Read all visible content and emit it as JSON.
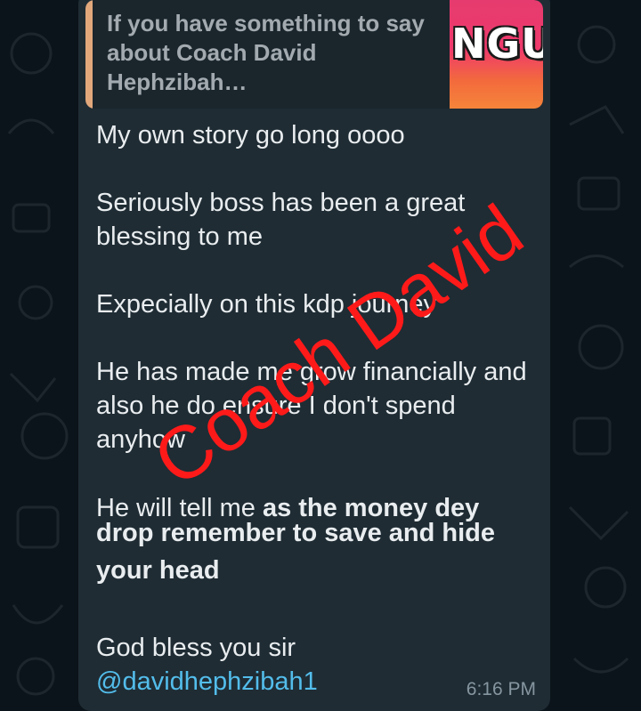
{
  "reply": {
    "text": "If you have something to say about Coach David Hephzibah…",
    "thumbnail_text": "NGU"
  },
  "message": {
    "line1": "My own story go long oooo",
    "para2": "Seriously boss has been a great blessing to me",
    "para3": "Expecially on this kdp journey",
    "para4": "He has made me grow financially and also he do ensure I don't spend anyhow",
    "para5_prefix": "He will tell me ",
    "para5_bold_first": "as the money dey",
    "para5_bold_rest": "drop remember to save and hide your head",
    "para6": "God bless you sir",
    "mention": "@davidhephzibah1"
  },
  "timestamp": "6:16 PM",
  "watermark": "Coach David",
  "colors": {
    "background": "#0b141a",
    "bubble": "#1f2c34",
    "reply_bar": "#e2a87c",
    "mention": "#53bdeb",
    "watermark": "#ff1a1a"
  }
}
